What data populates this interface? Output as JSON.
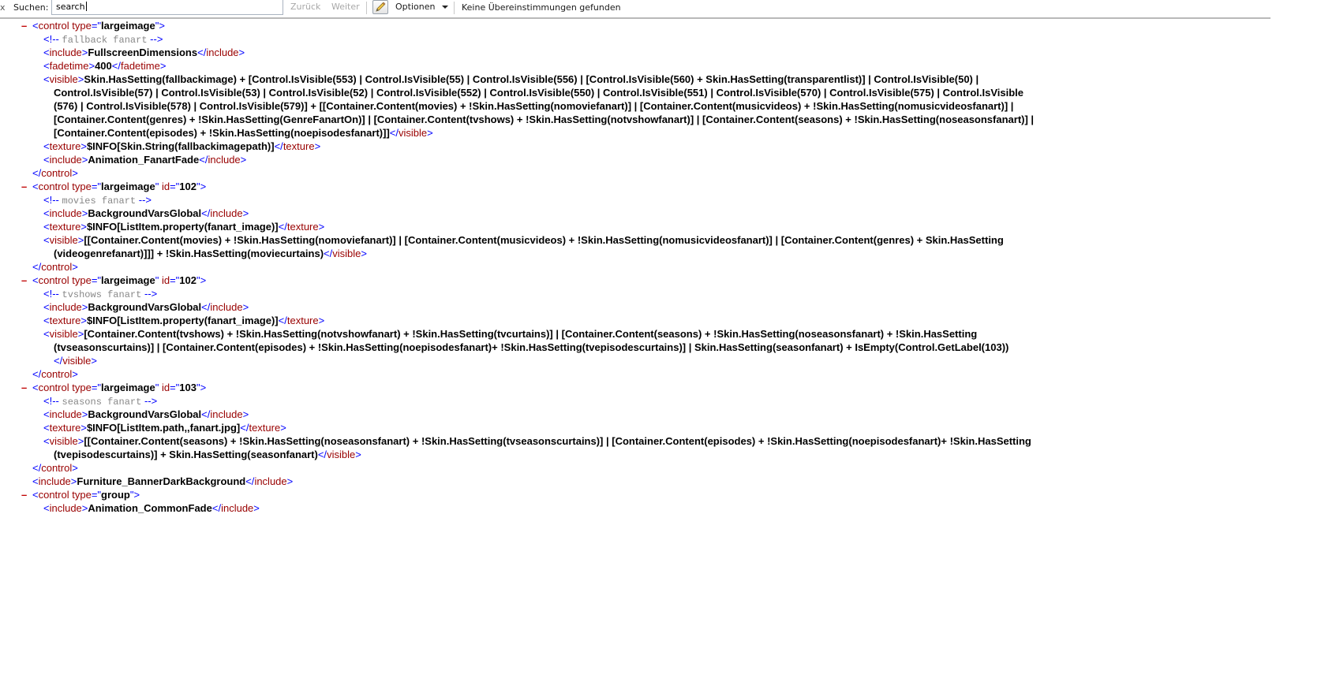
{
  "findbar": {
    "close_glyph": "x",
    "label": "Suchen:",
    "search_value": "search",
    "back_label": "Zurück",
    "next_label": "Weiter",
    "options_label": "Optionen",
    "status_text": "Keine Übereinstimmungen gefunden",
    "options_icon": "pencil-icon"
  },
  "xml": {
    "minus": "–",
    "b1": {
      "control_tag": "control",
      "type_attr": "type",
      "type_value": "largeimage",
      "comment": "fallback fanart",
      "include1_tag": "include",
      "include1_text": "FullscreenDimensions",
      "fadetime_tag": "fadetime",
      "fadetime_text": "400",
      "visible_tag": "visible",
      "visible_line1": "Skin.HasSetting(fallbackimage) + [Control.IsVisible(553) | Control.IsVisible(55) | Control.IsVisible(556) | [Control.IsVisible(560) + Skin.HasSetting(transparentlist)] | Control.IsVisible(50) |",
      "visible_line2": "Control.IsVisible(57) | Control.IsVisible(53) | Control.IsVisible(52) | Control.IsVisible(552) | Control.IsVisible(550) | Control.IsVisible(551) | Control.IsVisible(570) | Control.IsVisible(575) | Control.IsVisible",
      "visible_line3": "(576) | Control.IsVisible(578) | Control.IsVisible(579)] + [[Container.Content(movies) + !Skin.HasSetting(nomoviefanart)] | [Container.Content(musicvideos) + !Skin.HasSetting(nomusicvideosfanart)] |",
      "visible_line4": "[Container.Content(genres) + !Skin.HasSetting(GenreFanartOn)] | [Container.Content(tvshows) + !Skin.HasSetting(notvshowfanart)] | [Container.Content(seasons) + !Skin.HasSetting(noseasonsfanart)] |",
      "visible_line5": "[Container.Content(episodes) + !Skin.HasSetting(noepisodesfanart)]]",
      "texture_tag": "texture",
      "texture_text": "$INFO[Skin.String(fallbackimagepath)]",
      "include2_tag": "include",
      "include2_text": "Animation_FanartFade"
    },
    "b2": {
      "type_value": "largeimage",
      "id_attr": "id",
      "id_value": "102",
      "comment": "movies fanart",
      "include_text": "BackgroundVarsGlobal",
      "texture_text": "$INFO[ListItem.property(fanart_image)]",
      "visible_line1": "[[Container.Content(movies) + !Skin.HasSetting(nomoviefanart)] | [Container.Content(musicvideos) + !Skin.HasSetting(nomusicvideosfanart)] | [Container.Content(genres) + Skin.HasSetting",
      "visible_line2": "(videogenrefanart)]]] + !Skin.HasSetting(moviecurtains)"
    },
    "b3": {
      "type_value": "largeimage",
      "id_value": "102",
      "comment": "tvshows fanart",
      "include_text": "BackgroundVarsGlobal",
      "texture_text": "$INFO[ListItem.property(fanart_image)]",
      "visible_line1": "[Container.Content(tvshows) + !Skin.HasSetting(notvshowfanart) + !Skin.HasSetting(tvcurtains)] | [Container.Content(seasons) + !Skin.HasSetting(noseasonsfanart) + !Skin.HasSetting",
      "visible_line2": "(tvseasonscurtains)] | [Container.Content(episodes) + !Skin.HasSetting(noepisodesfanart)+ !Skin.HasSetting(tvepisodescurtains)] | Skin.HasSetting(seasonfanart) + IsEmpty(Control.GetLabel(103))"
    },
    "b4": {
      "type_value": "largeimage",
      "id_value": "103",
      "comment": "seasons fanart",
      "include_text": "BackgroundVarsGlobal",
      "texture_text": "$INFO[ListItem.path,,fanart.jpg]",
      "visible_line1": "[[Container.Content(seasons) + !Skin.HasSetting(noseasonsfanart) + !Skin.HasSetting(tvseasonscurtains)] | [Container.Content(episodes) + !Skin.HasSetting(noepisodesfanart)+ !Skin.HasSetting",
      "visible_line2": "(tvepisodescurtains)] + Skin.HasSetting(seasonfanart)"
    },
    "outer_include_text": "Furniture_BannerDarkBackground",
    "b5": {
      "type_value": "group",
      "include_text": "Animation_CommonFade"
    }
  }
}
